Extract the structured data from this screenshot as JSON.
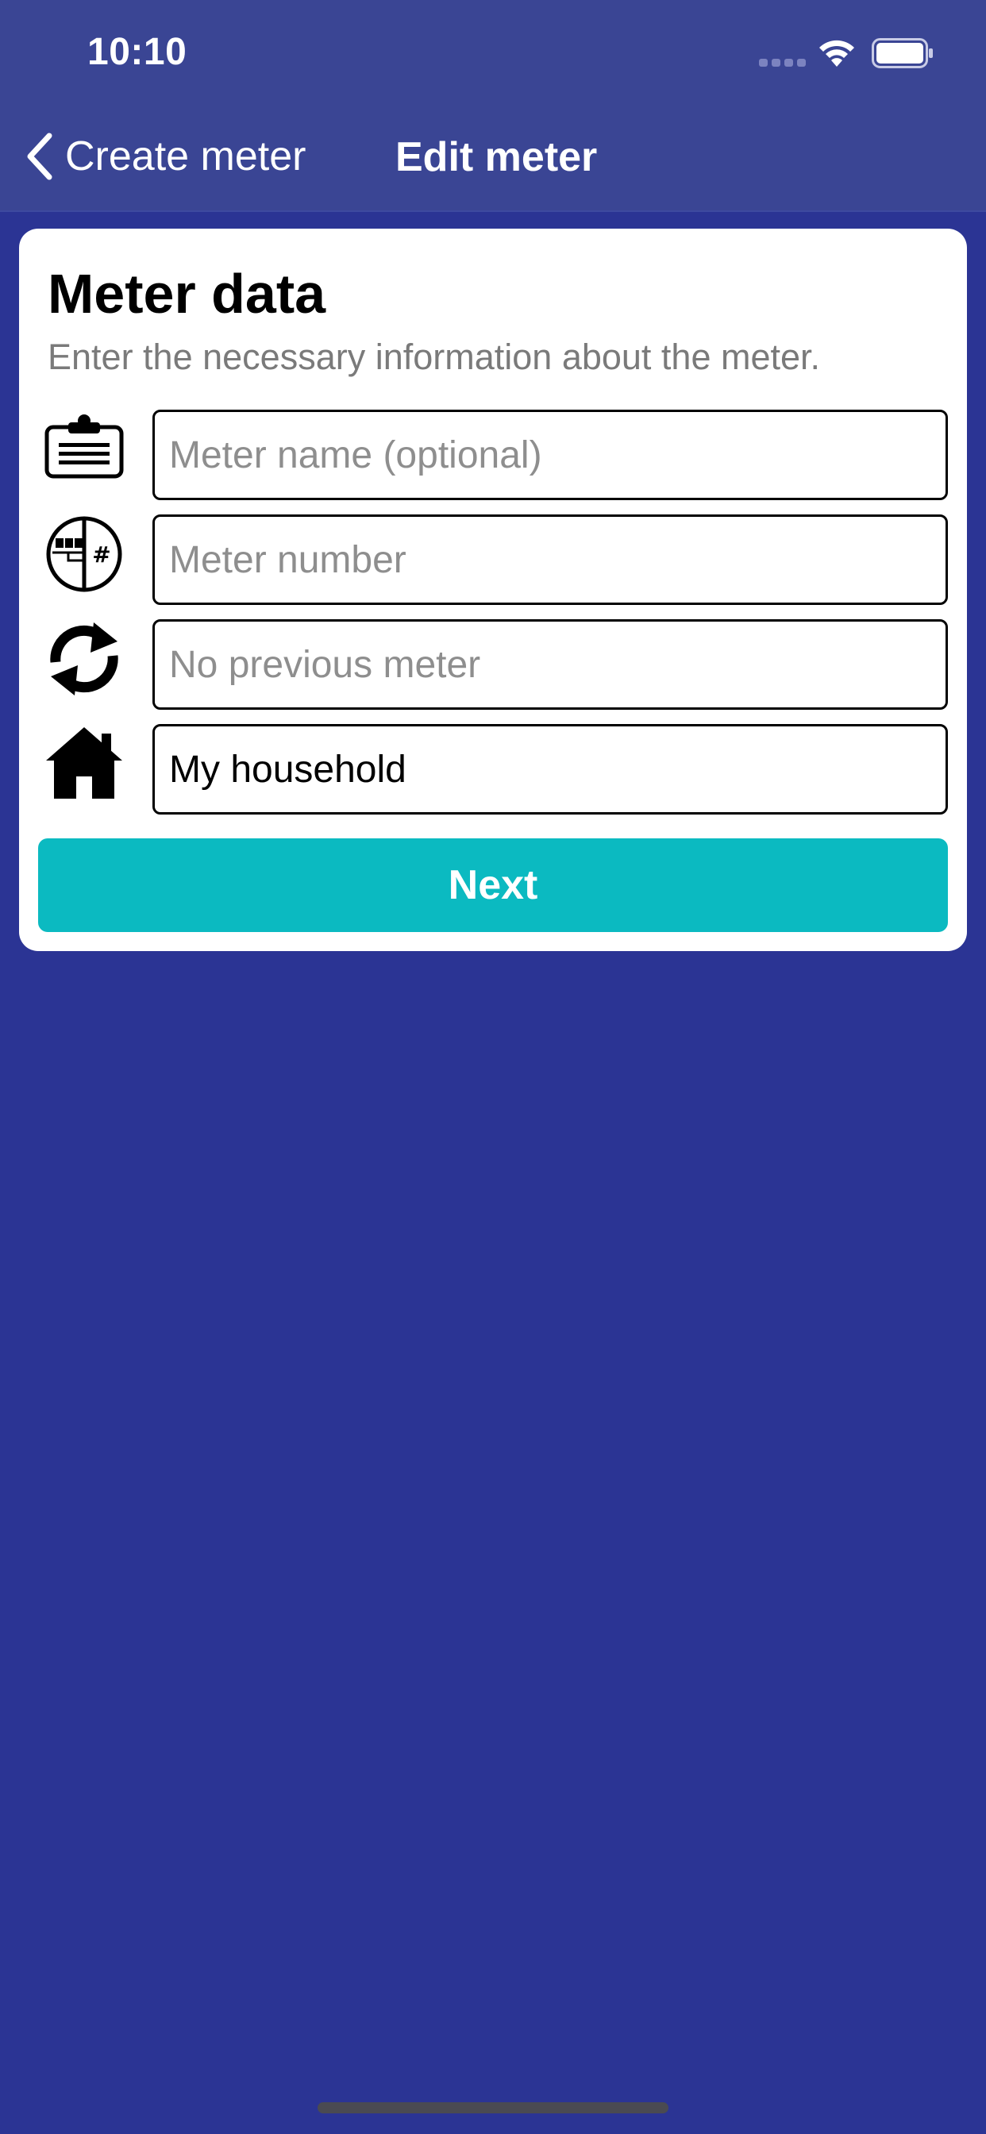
{
  "status_bar": {
    "time": "10:10"
  },
  "nav": {
    "back_label": "Create meter",
    "title": "Edit meter"
  },
  "card": {
    "title": "Meter data",
    "subtitle": "Enter the necessary information about the meter.",
    "fields": {
      "meter_name_placeholder": "Meter name (optional)",
      "meter_number_placeholder": "Meter number",
      "previous_meter_placeholder": "No previous meter",
      "household_value": "My household"
    },
    "icons": {
      "meter_name": "clipboard-icon",
      "meter_number": "meter-number-icon",
      "previous_meter": "refresh-icon",
      "household": "house-icon"
    },
    "next_label": "Next"
  },
  "colors": {
    "background": "#2b3494",
    "nav_background": "#3a4594",
    "accent": "#0bbac1",
    "card": "#ffffff",
    "placeholder": "#8e8e8e",
    "subtitle": "#7a7a7a"
  }
}
